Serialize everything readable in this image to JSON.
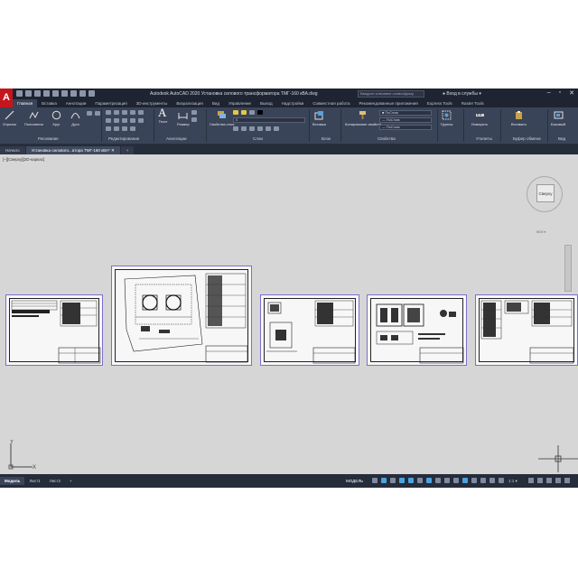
{
  "app": {
    "title": "Autodesk AutoCAD 2020   Установка силового трансформатора ТМГ-160 кВА.dwg",
    "search_placeholder": "Введите ключевое слово/фразу",
    "signin": "Вход в службы",
    "logo_letter": "A"
  },
  "ribbon_tabs": [
    "Главная",
    "Вставка",
    "Аннотации",
    "Параметризация",
    "3D-инструменты",
    "Визуализация",
    "Вид",
    "Управление",
    "Вывод",
    "Надстройки",
    "Совместная работа",
    "Рекомендованные приложения",
    "Express Tools",
    "Raster Tools"
  ],
  "ribbon": {
    "draw_buttons": [
      "Отрезок",
      "Полилиния",
      "Круг",
      "Дуга"
    ],
    "text_button": "Текст",
    "dim_button": "Размер",
    "layer_props_button": "Свойства слоя",
    "insert_button": "Вставка",
    "match_props_button": "Копирование свойств",
    "groups_button": "Группы",
    "measure_button": "Измерить",
    "paste_button": "Вставить",
    "base_button": "Базовый",
    "bylayer_1": "ПоСлою",
    "bylayer_2": "ПоСлою",
    "bylayer_3": "ПоСлою",
    "layer_value": "0",
    "panels": {
      "draw": "Рисование",
      "modify": "Редактирование",
      "annotation": "Аннотации",
      "layers": "Слои",
      "block": "Блок",
      "properties": "Свойства",
      "utilities": "Утилиты",
      "clipboard": "Буфер обмена",
      "view": "Вид"
    }
  },
  "file_tabs": [
    "Начало",
    "Установка силового...атора ТМГ-160 кВА*"
  ],
  "file_tabs_add": "+",
  "viewport": {
    "label": "[–][Сверху][2D-каркас]",
    "viewcube_face": "Сверху",
    "wcs": "МСК"
  },
  "statusbar": {
    "layout_tabs": [
      "Модель",
      "Лист1",
      "Лист2"
    ],
    "add_tab": "+",
    "model_label": "МОДЕЛЬ",
    "scale": "1:1"
  },
  "colors": {
    "app_dark": "#1e2431",
    "ribbon": "#3a4458",
    "canvas": "#d6d6d6",
    "sheet_border": "#7a6fd0",
    "logo_red": "#c4161c"
  }
}
